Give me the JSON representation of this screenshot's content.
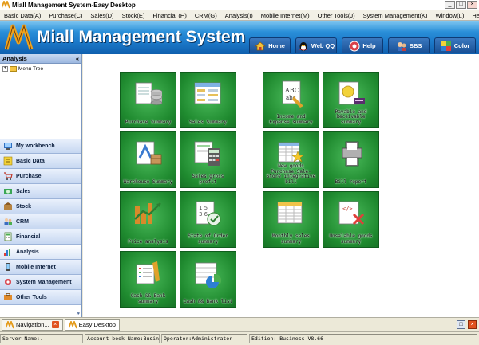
{
  "window": {
    "title": "Miall Management System-Easy Desktop"
  },
  "menu": [
    "Basic Data(A)",
    "Purchase(C)",
    "Sales(D)",
    "Stock(E)",
    "Financial (H)",
    "CRM(G)",
    "Analysis(I)",
    "Mobile Internet(M)",
    "Other Tools(J)",
    "System Management(K)",
    "Window(L)",
    "Help(M)"
  ],
  "banner": {
    "title": "Miall Management System",
    "nav": [
      {
        "label": "Home",
        "icon": "home-icon"
      },
      {
        "label": "Web QQ",
        "icon": "qq-penguin-icon"
      },
      {
        "label": "Help",
        "icon": "help-icon"
      },
      {
        "label": "BBS",
        "icon": "bbs-icon"
      },
      {
        "label": "Color",
        "icon": "color-palette-icon"
      }
    ]
  },
  "sidebar": {
    "header": "Analysis",
    "collapse_glyph": "«",
    "tree_root": "Menu Tree",
    "grip": "........",
    "more_glyph": "»",
    "items": [
      {
        "label": "My workbench",
        "icon": "workbench-icon"
      },
      {
        "label": "Basic Data",
        "icon": "basic-data-icon"
      },
      {
        "label": "Purchase",
        "icon": "purchase-icon"
      },
      {
        "label": "Sales",
        "icon": "sales-icon"
      },
      {
        "label": "Stock",
        "icon": "stock-icon"
      },
      {
        "label": "CRM",
        "icon": "crm-icon"
      },
      {
        "label": "Financial",
        "icon": "financial-icon"
      },
      {
        "label": "Analysis",
        "icon": "analysis-icon",
        "active": true
      },
      {
        "label": "Mobile Internet",
        "icon": "mobile-internet-icon"
      },
      {
        "label": "System Management",
        "icon": "system-management-icon"
      },
      {
        "label": "Other Tools",
        "icon": "other-tools-icon"
      }
    ]
  },
  "tiles": [
    {
      "label": "Purchase Summary",
      "icon": "purchase-summary-icon"
    },
    {
      "label": "Sales Summary",
      "icon": "sales-summary-icon"
    },
    {
      "label": "Income and Expense summary",
      "icon": "income-expense-icon"
    },
    {
      "label": "Payable and Receivable summary",
      "icon": "payable-receivable-icon"
    },
    {
      "label": "Warehouse Summary",
      "icon": "warehouse-summary-icon"
    },
    {
      "label": "Sales gross profit",
      "icon": "sales-gross-profit-icon"
    },
    {
      "label": "New goods Purchase-Sale-Store integrative bill",
      "icon": "integrative-bill-icon"
    },
    {
      "label": "Bill report",
      "icon": "bill-report-icon"
    },
    {
      "label": "Price analysis",
      "icon": "price-analysis-icon"
    },
    {
      "label": "State of Order summary",
      "icon": "order-state-icon"
    },
    {
      "label": "Monthly sales summary",
      "icon": "monthly-sales-icon"
    },
    {
      "label": "Unsalable goods summary",
      "icon": "unsalable-goods-icon"
    },
    {
      "label": "Cash && Bank summary",
      "icon": "cash-bank-summary-icon"
    },
    {
      "label": "Cash && Bank list",
      "icon": "cash-bank-list-icon"
    }
  ],
  "taskbar": {
    "tasks": [
      {
        "label": "Navigation...",
        "icon": "navigation-logo-icon"
      },
      {
        "label": "Easy Desktop",
        "icon": "desktop-logo-icon"
      }
    ]
  },
  "status": {
    "server": "Server Name:.",
    "account": "Account-book Name:Business(Defaul",
    "operator": "Operator:Administrator",
    "edition": "Edition:  Business V8.66"
  },
  "colors": {
    "tile_green": "#1f8a2f",
    "banner_blue": "#1d7ccc",
    "sidebar_blue": "#c6d7f1"
  }
}
